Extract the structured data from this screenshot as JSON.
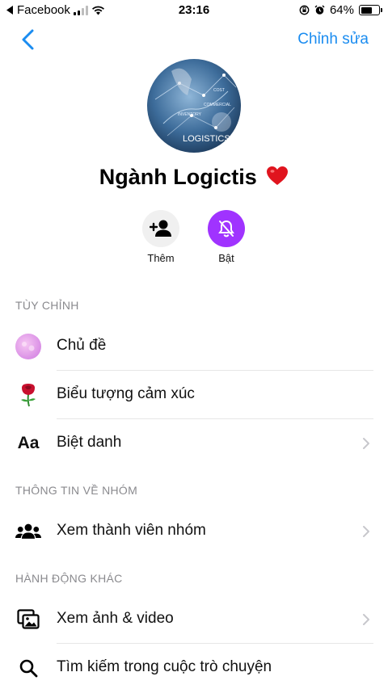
{
  "status_bar": {
    "back_app": "Facebook",
    "time": "23:16",
    "battery_text": "64%",
    "battery_level": 0.64
  },
  "nav": {
    "edit_label": "Chỉnh sửa"
  },
  "profile": {
    "name": "Ngành Logictis",
    "avatar_text": "LOGISTICS",
    "avatar_subtext_1": "INVENTORY",
    "avatar_subtext_2": "COMMERCIAL",
    "avatar_subtext_3": "COST"
  },
  "actions": {
    "add_label": "Thêm",
    "mute_label": "Bật"
  },
  "sections": {
    "customize": {
      "header": "TÙY CHỈNH",
      "theme_label": "Chủ đề",
      "emoji_label": "Biểu tượng cảm xúc",
      "nickname_label": "Biệt danh",
      "nickname_icon_text": "Aa"
    },
    "group_info": {
      "header": "THÔNG TIN VỀ NHÓM",
      "members_label": "Xem thành viên nhóm"
    },
    "other_actions": {
      "header": "HÀNH ĐỘNG KHÁC",
      "media_label": "Xem ảnh & video",
      "search_label": "Tìm kiếm trong cuộc trò chuyện"
    }
  },
  "colors": {
    "accent_blue": "#1a8cf0",
    "mute_purple": "#a033ff",
    "section_gray": "#8a8a8e"
  }
}
